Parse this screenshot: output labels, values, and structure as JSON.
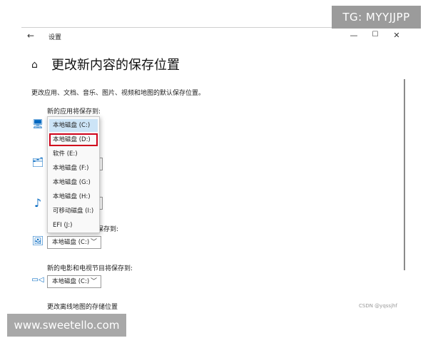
{
  "window": {
    "title": "设置",
    "back_icon": "←",
    "minimize_icon": "—",
    "maximize_icon": "☐",
    "close_icon": "✕"
  },
  "page": {
    "home_icon": "⌂",
    "title": "更改新内容的保存位置",
    "description": "更改应用、文档、音乐、图片、视频和地图的默认保存位置。"
  },
  "sections": {
    "apps_label": "新的应用将保存到:",
    "pictures_label_partial": "保存到:",
    "pictures_value": "本地磁盘 (C:)",
    "movies_label": "新的电影和电视节目将保存到:",
    "movies_value": "本地磁盘 (C:)",
    "offline_maps_label": "更改离线地图的存储位置"
  },
  "icons": {
    "apps": "🖥",
    "documents": "🗂",
    "music": "♪",
    "pictures": "🖼",
    "movies": "▭◁"
  },
  "dropdown_options": [
    "本地磁盘 (C:)",
    "本地磁盘 (D:)",
    "软件 (E:)",
    "本地磁盘 (F:)",
    "本地磁盘 (G:)",
    "本地磁盘 (H:)",
    "可移动磁盘 (I:)",
    "EFI (J:)"
  ],
  "dropdown_selected_index": 0,
  "dropdown_highlighted_index": 1,
  "chevron": "﹀",
  "colors": {
    "accent": "#0067c0",
    "selected_option": "#cce4f7",
    "highlight_border": "#d0021b"
  },
  "watermarks": {
    "tg": "TG: MYYJJPP",
    "site": "www.sweetello.com",
    "csdn": "CSDN @yqssjhf"
  }
}
